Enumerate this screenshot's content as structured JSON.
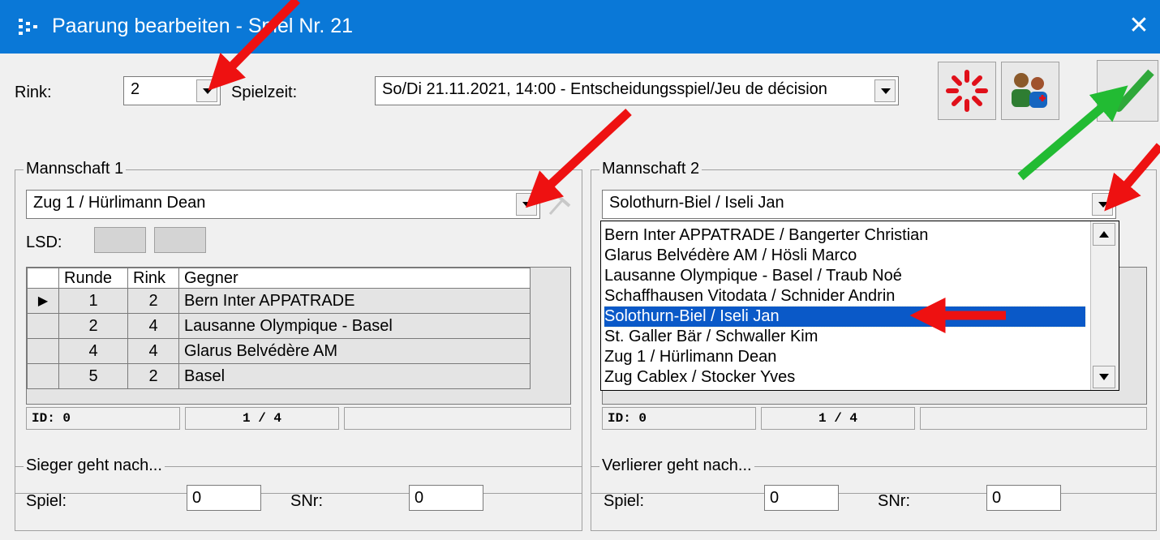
{
  "window": {
    "title": "Paarung bearbeiten - Spiel Nr. 21",
    "close_icon": "close-icon"
  },
  "top": {
    "rink_label": "Rink:",
    "rink_value": "2",
    "spielzeit_label": "Spielzeit:",
    "spielzeit_value": "So/Di 21.11.2021, 14:00 - Entscheidungsspiel/Jeu de décision"
  },
  "team1": {
    "group_title": "Mannschaft 1",
    "selected": "Zug 1 / Hürlimann Dean",
    "lsd_label": "LSD:",
    "columns": [
      "Runde",
      "Rink",
      "Gegner"
    ],
    "rows": [
      {
        "runde": "1",
        "rink": "2",
        "gegner": "Bern Inter APPATRADE"
      },
      {
        "runde": "2",
        "rink": "4",
        "gegner": "Lausanne Olympique - Basel"
      },
      {
        "runde": "4",
        "rink": "4",
        "gegner": "Glarus Belvédère AM"
      },
      {
        "runde": "5",
        "rink": "2",
        "gegner": "Basel"
      }
    ],
    "status_id": "ID: 0",
    "status_page": "1 / 4"
  },
  "team2": {
    "group_title": "Mannschaft 2",
    "selected": "Solothurn-Biel / Iseli Jan",
    "dropdown_items": [
      "Bern Inter APPATRADE / Bangerter Christian",
      "Glarus Belvédère AM / Hösli Marco",
      "Lausanne Olympique - Basel / Traub Noé",
      "Schaffhausen Vitodata / Schnider Andrin",
      "Solothurn-Biel / Iseli Jan",
      "St. Galler Bär / Schwaller Kim",
      "Zug 1 / Hürlimann Dean",
      "Zug Cablex / Stocker Yves"
    ],
    "selected_index": 4,
    "status_id": "ID: 0",
    "status_page": "1 / 4"
  },
  "winner": {
    "group_title": "Sieger geht nach...",
    "spiel_label": "Spiel:",
    "spiel_value": "0",
    "snr_label": "SNr:",
    "snr_value": "0"
  },
  "loser": {
    "group_title": "Verlierer geht nach...",
    "spiel_label": "Spiel:",
    "spiel_value": "0",
    "snr_label": "SNr:",
    "snr_value": "0"
  },
  "colors": {
    "titlebar": "#0a78d7",
    "selection": "#0a59c8",
    "annotation_red": "#ee1111",
    "annotation_green": "#22bb33"
  }
}
